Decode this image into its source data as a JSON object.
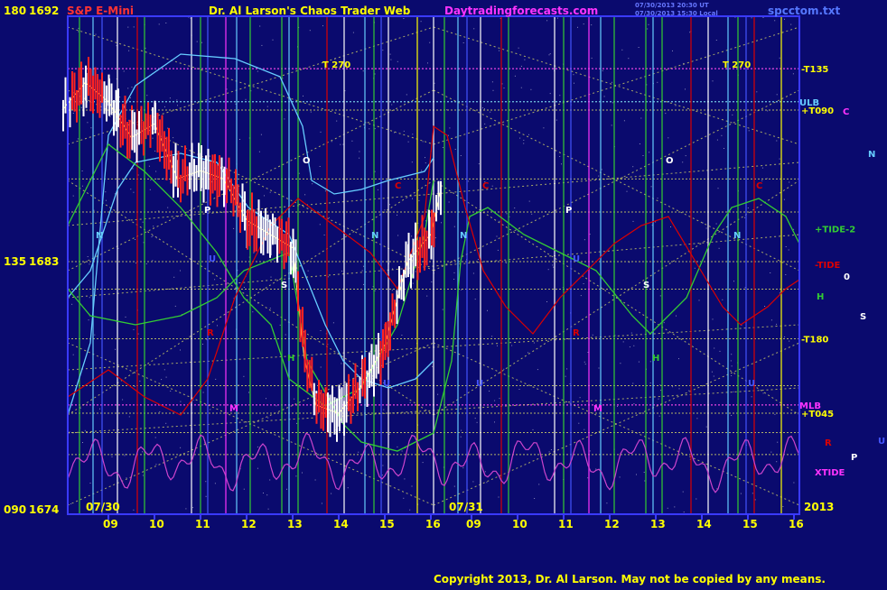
{
  "header": {
    "instrument": "S&P E-Mini",
    "web_title": "Dr. Al Larson's Chaos Trader Web",
    "site": "Daytradingforecasts.com",
    "file": "spcctom.txt",
    "stamp_line1": "07/30/2013 20:30 UT",
    "stamp_line2": "07/30/2013 15:30 Local"
  },
  "footer": {
    "copyright": "Copyright 2013, Dr. Al Larson. May not be copied by any means."
  },
  "colors": {
    "background": "#0a0a6e",
    "axis": "#3a3aff",
    "yellow": "#ffff00",
    "magenta": "#ff33ff",
    "cyan": "#66ccff",
    "green": "#33cc33",
    "red": "#dd0000",
    "white": "#ffffff",
    "dotted_grid": "#dddd66"
  },
  "chart_data": {
    "type": "line",
    "title": "S&P E-Mini",
    "y_axis": {
      "ticks": [
        {
          "angle": "180",
          "price": "1692"
        },
        {
          "angle": "135",
          "price": "1683"
        },
        {
          "angle": "090",
          "price": "1674"
        }
      ],
      "ylim": [
        1674,
        1692
      ]
    },
    "x_axis": {
      "day_labels": [
        "07/30",
        "07/31",
        "2013"
      ],
      "hour_ticks_day1": [
        "09",
        "10",
        "11",
        "12",
        "13",
        "14",
        "15",
        "16"
      ],
      "hour_ticks_day2": [
        "09",
        "10",
        "11",
        "12",
        "13",
        "14",
        "15",
        "16"
      ]
    },
    "price_bars": {
      "x_hours": [
        8.0,
        8.5,
        9.0,
        9.5,
        10.0,
        10.5,
        11.0,
        11.5,
        12.0,
        12.5,
        13.0,
        13.25,
        13.5,
        14.0,
        14.5,
        15.0,
        15.5,
        16.0,
        16.2
      ],
      "close": [
        1688.5,
        1689.5,
        1688.8,
        1687.5,
        1688.0,
        1686.0,
        1686.3,
        1686.0,
        1684.5,
        1684.0,
        1683.5,
        1679.5,
        1677.8,
        1677.5,
        1678.5,
        1680.0,
        1683.0,
        1684.0,
        1685.5
      ]
    },
    "time_labels": {
      "t270_day1": "T   270",
      "t270_day2": "T   270"
    },
    "right_labels": [
      {
        "text": "-T135",
        "price": 1690.0,
        "color": "yellow"
      },
      {
        "text": "C",
        "price": 1690.0,
        "color": "magenta"
      },
      {
        "text": "ULB",
        "price": 1688.8,
        "color": "cyan"
      },
      {
        "text": "N",
        "price": 1688.9,
        "color": "cyan"
      },
      {
        "text": "+T090",
        "price": 1688.5,
        "color": "yellow"
      },
      {
        "text": "+TIDE-2",
        "price": 1684.2,
        "color": "green"
      },
      {
        "text": "-TIDE",
        "price": 1682.9,
        "color": "red"
      },
      {
        "text": "0",
        "price": 1683.0,
        "color": "white"
      },
      {
        "text": "H",
        "price": 1682.4,
        "color": "green"
      },
      {
        "text": "S",
        "price": 1681.9,
        "color": "white"
      },
      {
        "text": "-T180",
        "price": 1680.2,
        "color": "yellow"
      },
      {
        "text": "MLB",
        "price": 1677.8,
        "color": "magenta"
      },
      {
        "text": "+T045",
        "price": 1677.5,
        "color": "yellow"
      },
      {
        "text": "R",
        "price": 1676.2,
        "color": "red"
      },
      {
        "text": "U",
        "price": 1676.2,
        "color": "blue"
      },
      {
        "text": "P",
        "price": 1675.8,
        "color": "white"
      },
      {
        "text": "XTIDE",
        "price": 1675.5,
        "color": "magenta"
      }
    ],
    "planet_markers": [
      {
        "text": "O",
        "x": 335,
        "y": 181,
        "color": "white"
      },
      {
        "text": "O",
        "x": 737,
        "y": 181,
        "color": "white"
      },
      {
        "text": "N",
        "x": 106,
        "y": 264,
        "color": "cyan"
      },
      {
        "text": "N",
        "x": 411,
        "y": 264,
        "color": "cyan"
      },
      {
        "text": "N",
        "x": 509,
        "y": 264,
        "color": "cyan"
      },
      {
        "text": "N",
        "x": 812,
        "y": 264,
        "color": "cyan"
      },
      {
        "text": "P",
        "x": 226,
        "y": 236,
        "color": "white"
      },
      {
        "text": "P",
        "x": 626,
        "y": 236,
        "color": "white"
      },
      {
        "text": "S",
        "x": 311,
        "y": 319,
        "color": "white"
      },
      {
        "text": "S",
        "x": 712,
        "y": 319,
        "color": "white"
      },
      {
        "text": "H",
        "x": 318,
        "y": 400,
        "color": "green"
      },
      {
        "text": "H",
        "x": 722,
        "y": 400,
        "color": "green"
      },
      {
        "text": "R",
        "x": 229,
        "y": 372,
        "color": "red"
      },
      {
        "text": "R",
        "x": 634,
        "y": 372,
        "color": "red"
      },
      {
        "text": "C",
        "x": 437,
        "y": 209,
        "color": "red"
      },
      {
        "text": "C",
        "x": 534,
        "y": 209,
        "color": "red"
      },
      {
        "text": "C",
        "x": 837,
        "y": 209,
        "color": "red"
      },
      {
        "text": "U",
        "x": 231,
        "y": 290,
        "color": "blue"
      },
      {
        "text": "U",
        "x": 634,
        "y": 290,
        "color": "blue"
      },
      {
        "text": "U",
        "x": 424,
        "y": 428,
        "color": "blue"
      },
      {
        "text": "U",
        "x": 527,
        "y": 428,
        "color": "blue"
      },
      {
        "text": "U",
        "x": 828,
        "y": 428,
        "color": "blue"
      },
      {
        "text": "M",
        "x": 254,
        "y": 456,
        "color": "magenta"
      },
      {
        "text": "M",
        "x": 657,
        "y": 456,
        "color": "magenta"
      }
    ],
    "grid": true,
    "legend": "none"
  }
}
